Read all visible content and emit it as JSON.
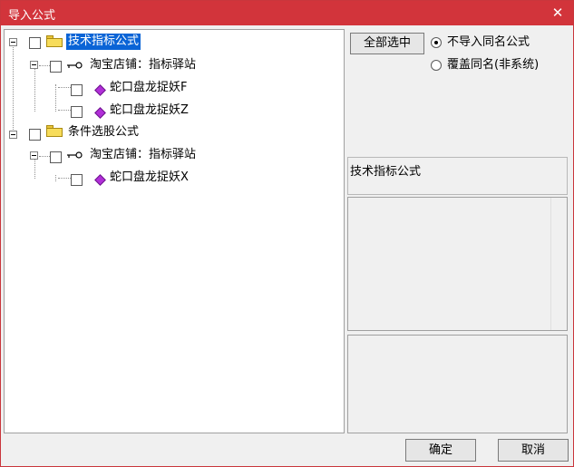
{
  "window": {
    "title": "导入公式"
  },
  "tree": {
    "nodes": [
      {
        "label": "技术指标公式"
      },
      {
        "label": "淘宝店铺：指标驿站"
      },
      {
        "label": "蛇口盘龙捉妖F"
      },
      {
        "label": "蛇口盘龙捉妖Z"
      },
      {
        "label": "条件选股公式"
      },
      {
        "label": "淘宝店铺：指标驿站"
      },
      {
        "label": "蛇口盘龙捉妖X"
      }
    ]
  },
  "options": {
    "select_all": "全部选中",
    "radio_skip": "不导入同名公式",
    "radio_overwrite": "覆盖同名(非系统)"
  },
  "info": {
    "category": "技术指标公式"
  },
  "footer": {
    "ok": "确定",
    "cancel": "取消"
  },
  "colors": {
    "titlebar": "#d2343b",
    "selection": "#0a64d6",
    "diamond": "#b12fd8"
  }
}
